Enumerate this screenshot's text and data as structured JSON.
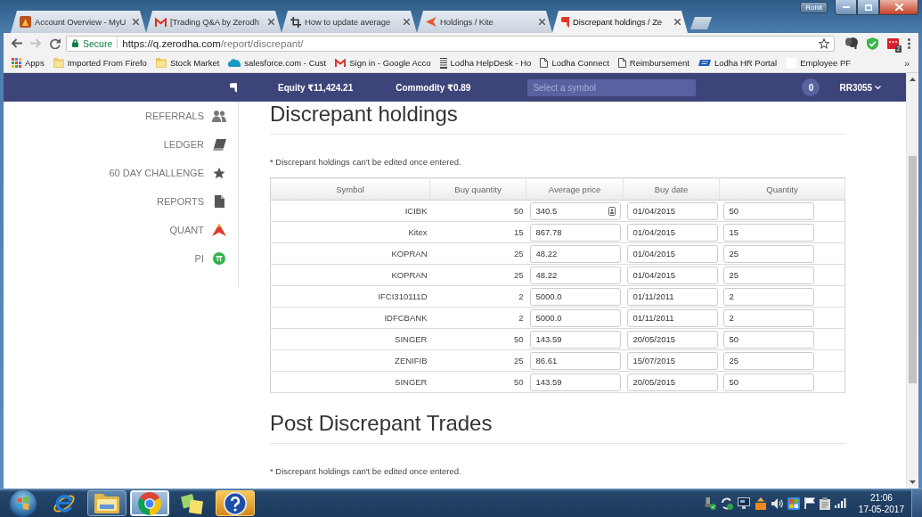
{
  "window": {
    "profile": "Rohit"
  },
  "tabs": [
    {
      "title": "Account Overview - MyU",
      "selected": false
    },
    {
      "title": "[Trading Q&A by Zerodh",
      "selected": false
    },
    {
      "title": "How to update average",
      "selected": false
    },
    {
      "title": "Holdings / Kite",
      "selected": false
    },
    {
      "title": "Discrepant holdings / Ze",
      "selected": true
    }
  ],
  "toolbar": {
    "back": {
      "disabled": false
    },
    "forward": {
      "disabled": true
    },
    "security": "Secure",
    "url": {
      "host": "https://q.zerodha.com",
      "path": "/report/discrepant/"
    },
    "extension_badge": "2"
  },
  "bookmarks": {
    "items": [
      "Apps",
      "Imported From Firefo",
      "Stock Market",
      "salesforce.com - Cust",
      "Sign in - Google Acco",
      "Lodha HelpDesk - Ho",
      "Lodha Connect",
      "Reimbursement",
      "Lodha HR Portal",
      "Employee PF"
    ],
    "overflow": "»"
  },
  "navbar": {
    "equity": "Equity ₹11,424.21",
    "commodity": "Commodity ₹0.89",
    "search": {
      "placeholder": "Select a symbol"
    },
    "notifications": "0",
    "user": "RR3055"
  },
  "sidebar": {
    "items": [
      "REFERRALS",
      "LEDGER",
      "60 DAY CHALLENGE",
      "REPORTS",
      "QUANT",
      "PI"
    ]
  },
  "sections": [
    {
      "title": "Discrepant holdings",
      "note": "* Discrepant holdings can't be edited once entered.",
      "table": {
        "columns": [
          "Symbol",
          "Buy quantity",
          "Average price",
          "Buy date",
          "Quantity"
        ],
        "rows": [
          {
            "symbol": "ICIBK",
            "buy_quantity": "50",
            "average_price": "340.5",
            "buy_date": "01/04/2015",
            "quantity": "50",
            "autofill": true
          },
          {
            "symbol": "Kitex",
            "buy_quantity": "15",
            "average_price": "867.78",
            "buy_date": "01/04/2015",
            "quantity": "15",
            "autofill": false
          },
          {
            "symbol": "KOPRAN",
            "buy_quantity": "25",
            "average_price": "48.22",
            "buy_date": "01/04/2015",
            "quantity": "25",
            "autofill": false
          },
          {
            "symbol": "KOPRAN",
            "buy_quantity": "25",
            "average_price": "48.22",
            "buy_date": "01/04/2015",
            "quantity": "25",
            "autofill": false
          },
          {
            "symbol": "IFCI310111D",
            "buy_quantity": "2",
            "average_price": "5000.0",
            "buy_date": "01/11/2011",
            "quantity": "2",
            "autofill": false
          },
          {
            "symbol": "IDFCBANK",
            "buy_quantity": "2",
            "average_price": "5000.0",
            "buy_date": "01/11/2011",
            "quantity": "2",
            "autofill": false
          },
          {
            "symbol": "SINGER",
            "buy_quantity": "50",
            "average_price": "143.59",
            "buy_date": "20/05/2015",
            "quantity": "50",
            "autofill": false
          },
          {
            "symbol": "ZENIFIB",
            "buy_quantity": "25",
            "average_price": "86.61",
            "buy_date": "15/07/2015",
            "quantity": "25",
            "autofill": false
          },
          {
            "symbol": "SINGER",
            "buy_quantity": "50",
            "average_price": "143.59",
            "buy_date": "20/05/2015",
            "quantity": "50",
            "autofill": false
          }
        ]
      }
    },
    {
      "title": "Post Discrepant Trades",
      "note": "* Discrepant holdings can't be edited once entered."
    }
  ],
  "taskbar": {
    "apps": [
      {
        "running": false,
        "selected": false,
        "flashing": false
      },
      {
        "running": true,
        "selected": false,
        "flashing": false
      },
      {
        "running": true,
        "selected": true,
        "flashing": false
      },
      {
        "running": false,
        "selected": false,
        "flashing": false
      },
      {
        "running": true,
        "selected": false,
        "flashing": true
      }
    ],
    "clock": {
      "time": "21:06",
      "date": "17-05-2017"
    }
  }
}
